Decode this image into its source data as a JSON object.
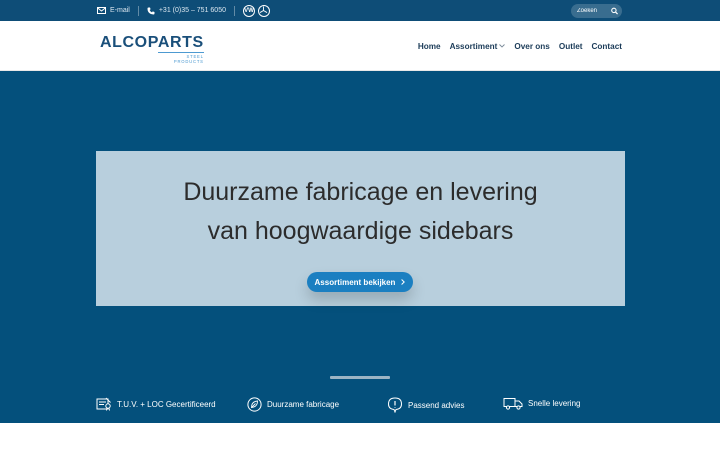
{
  "topbar": {
    "email_label": "E-mail",
    "phone_label": "+31 (0)35 – 751 6050",
    "brands": [
      "VW",
      "M"
    ],
    "search_placeholder": "Zoeken"
  },
  "header": {
    "logo_main": "ALCO",
    "logo_accent": "PARTS",
    "logo_sub": "STEEL PRODUCTS",
    "nav": [
      "Home",
      "Assortiment",
      "Over ons",
      "Outlet",
      "Contact"
    ]
  },
  "hero": {
    "title_line1": "Duurzame fabricage en levering",
    "title_line2": "van hoogwaardige sidebars",
    "cta_label": "Assortiment bekijken"
  },
  "features": [
    {
      "label": "T.U.V. + LOC Gecertificeerd",
      "icon": "certificate-icon"
    },
    {
      "label": "Duurzame fabricage",
      "icon": "leaf-icon"
    },
    {
      "label": "Passend advies",
      "icon": "advice-icon"
    },
    {
      "label": "Snelle levering",
      "icon": "truck-icon"
    }
  ],
  "colors": {
    "topbar": "#0e4d77",
    "hero_bg": "#04507c",
    "hero_box": "#b8cfdd",
    "button": "#1b7fc1",
    "nav_text": "#1b3b58"
  }
}
